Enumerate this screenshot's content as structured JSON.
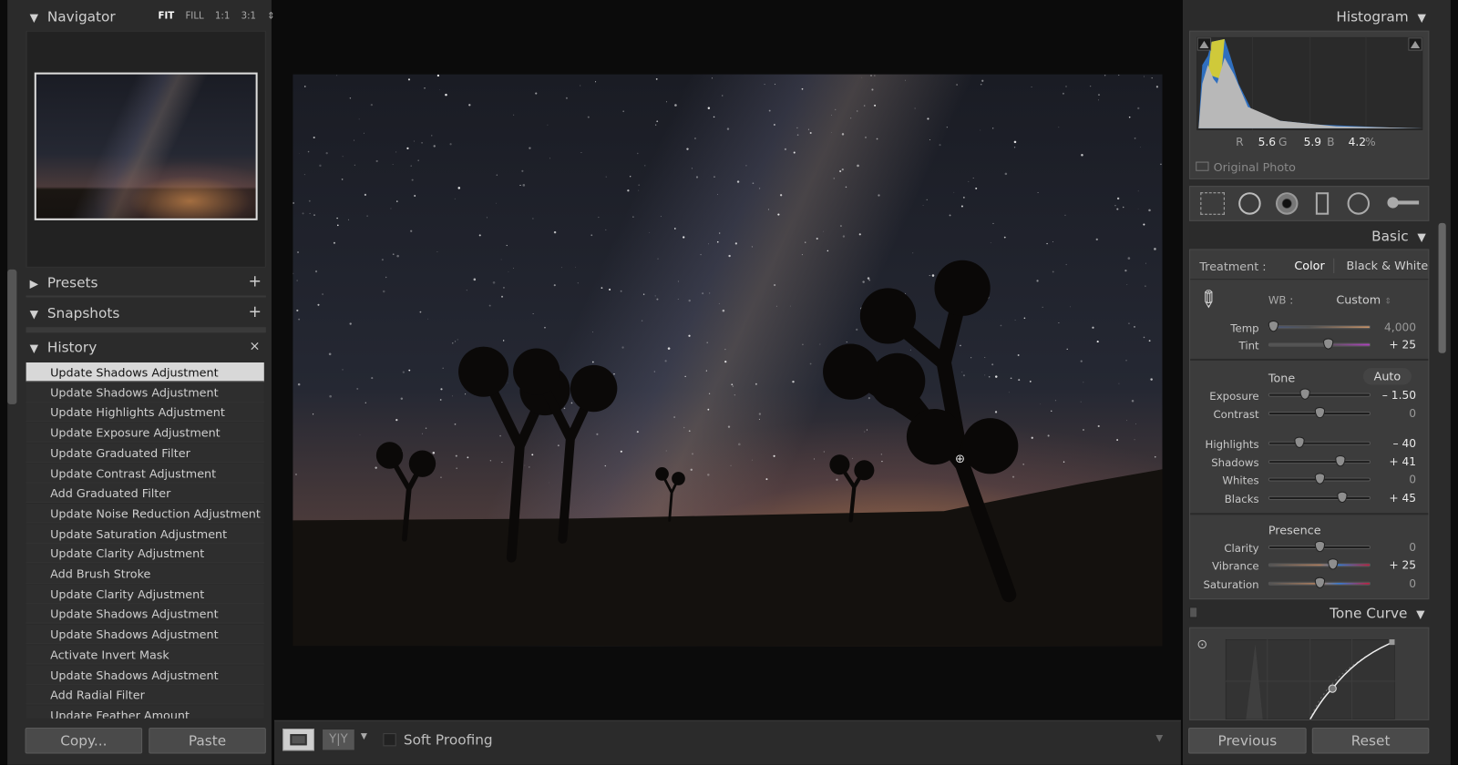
{
  "navigator": {
    "title": "Navigator",
    "zoom_options": [
      "FIT",
      "FILL",
      "1:1",
      "3:1"
    ],
    "active_zoom": "FIT"
  },
  "presets": {
    "title": "Presets"
  },
  "snapshots": {
    "title": "Snapshots"
  },
  "history": {
    "title": "History",
    "items": [
      "Update Shadows Adjustment",
      "Update Shadows Adjustment",
      "Update Highlights Adjustment",
      "Update Exposure Adjustment",
      "Update Graduated Filter",
      "Update Contrast Adjustment",
      "Add Graduated Filter",
      "Update Noise Reduction Adjustment",
      "Update Saturation Adjustment",
      "Update Clarity Adjustment",
      "Add Brush Stroke",
      "Update Clarity Adjustment",
      "Update Shadows Adjustment",
      "Update Shadows Adjustment",
      "Activate Invert Mask",
      "Update Shadows Adjustment",
      "Add Radial Filter",
      "Update Feather Amount"
    ],
    "selected_index": 0
  },
  "left_buttons": {
    "copy": "Copy...",
    "paste": "Paste"
  },
  "toolbar": {
    "soft_proofing": "Soft Proofing",
    "soft_proofing_checked": false
  },
  "histogram": {
    "title": "Histogram",
    "r_label": "R",
    "r": "5.6",
    "g_label": "G",
    "g": "5.9",
    "b_label": "B",
    "b": "4.2",
    "pct": "%",
    "original_photo": "Original Photo"
  },
  "tools": [
    "crop-overlay-icon",
    "spot-removal-icon",
    "red-eye-icon",
    "graduated-filter-icon",
    "radial-filter-icon",
    "adjustment-brush-icon"
  ],
  "basic": {
    "title": "Basic",
    "treatment_label": "Treatment :",
    "treatment_color": "Color",
    "treatment_bw": "Black & White",
    "wb_label": "WB :",
    "wb_value": "Custom",
    "tone_label": "Tone",
    "auto": "Auto",
    "presence_label": "Presence",
    "sliders": [
      {
        "label": "Temp",
        "value": 4000,
        "min": 2000,
        "max": 50000,
        "display": "4,000",
        "track": "temp"
      },
      {
        "label": "Tint",
        "value": 25,
        "min": -150,
        "max": 150,
        "display": "+ 25",
        "track": "tint"
      },
      {
        "label": "Exposure",
        "value": -1.5,
        "min": -5,
        "max": 5,
        "display": "– 1.50"
      },
      {
        "label": "Contrast",
        "value": 0,
        "min": -100,
        "max": 100,
        "display": "0"
      },
      {
        "label": "Highlights",
        "value": -40,
        "min": -100,
        "max": 100,
        "display": "– 40"
      },
      {
        "label": "Shadows",
        "value": 41,
        "min": -100,
        "max": 100,
        "display": "+ 41"
      },
      {
        "label": "Whites",
        "value": 0,
        "min": -100,
        "max": 100,
        "display": "0"
      },
      {
        "label": "Blacks",
        "value": 45,
        "min": -100,
        "max": 100,
        "display": "+ 45"
      },
      {
        "label": "Clarity",
        "value": 0,
        "min": -100,
        "max": 100,
        "display": "0"
      },
      {
        "label": "Vibrance",
        "value": 25,
        "min": -100,
        "max": 100,
        "display": "+ 25",
        "track": "sat"
      },
      {
        "label": "Saturation",
        "value": 0,
        "min": -100,
        "max": 100,
        "display": "0",
        "track": "sat"
      }
    ]
  },
  "tone_curve": {
    "title": "Tone Curve"
  },
  "right_buttons": {
    "previous": "Previous",
    "reset": "Reset"
  }
}
